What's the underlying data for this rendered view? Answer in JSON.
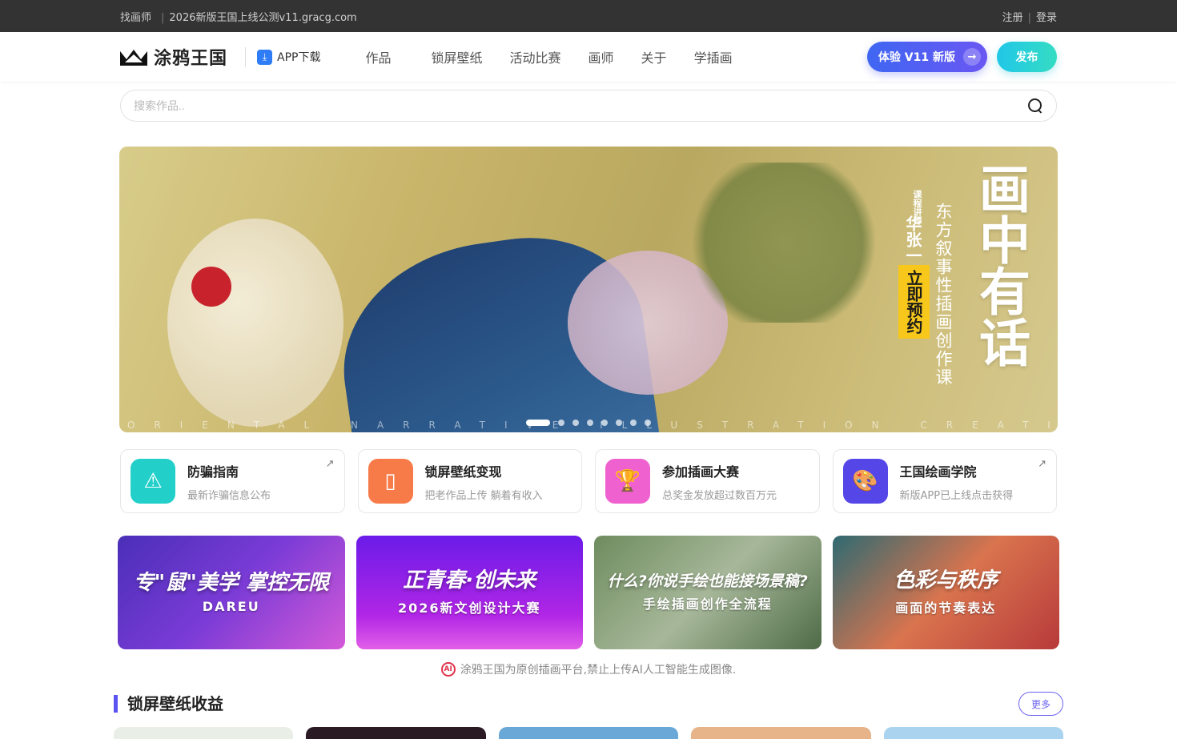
{
  "topbar": {
    "left_label": "找画师",
    "announcement": "2026新版王国上线公测v11.gracg.com",
    "register": "注册",
    "login": "登录"
  },
  "header": {
    "logo_text": "涂鸦王国",
    "app_download": "APP下载",
    "nav": [
      "作品",
      "锁屏壁纸",
      "活动比赛",
      "画师",
      "关于",
      "学插画"
    ],
    "v11_button": "体验 V11 新版",
    "publish_button": "发布"
  },
  "search": {
    "placeholder": "搜索作品.."
  },
  "banner": {
    "title": "画中有话",
    "subtitle": "东方叙事性插画创作课",
    "teacher_label": "课程讲师",
    "teacher_name": "华张一",
    "cta": "立即预约",
    "english": "ORIENTAL NARRATIVE ILLUSTRATION CREATION COURSE",
    "dots_count": 8,
    "active_dot": 0
  },
  "cards": [
    {
      "title": "防骗指南",
      "desc": "最新诈骗信息公布",
      "icon": "warning-icon",
      "color": "#22cfc9",
      "external": true
    },
    {
      "title": "锁屏壁纸变现",
      "desc": "把老作品上传 躺着有收入",
      "icon": "tablet-icon",
      "color": "#f77b48",
      "external": false
    },
    {
      "title": "参加插画大赛",
      "desc": "总奖金发放超过数百万元",
      "icon": "trophy-icon",
      "color": "#f061d0",
      "external": false
    },
    {
      "title": "王国绘画学院",
      "desc": "新版APP已上线点击获得",
      "icon": "palette-icon",
      "color": "#5546e8",
      "external": true
    }
  ],
  "promos": [
    {
      "title": "专\"鼠\"美学 掌控无限",
      "sub": "DAREU"
    },
    {
      "title": "正青春·创未来",
      "sub": "2026新文创设计大赛"
    },
    {
      "title": "什么?你说手绘也能接场景稿?",
      "sub": "手绘插画创作全流程"
    },
    {
      "title": "色彩与秩序",
      "sub": "画面的节奏表达"
    }
  ],
  "notice": "涂鸦王国为原创插画平台,禁止上传AI人工智能生成图像.",
  "section": {
    "title": "锁屏壁纸收益",
    "more": "更多"
  }
}
